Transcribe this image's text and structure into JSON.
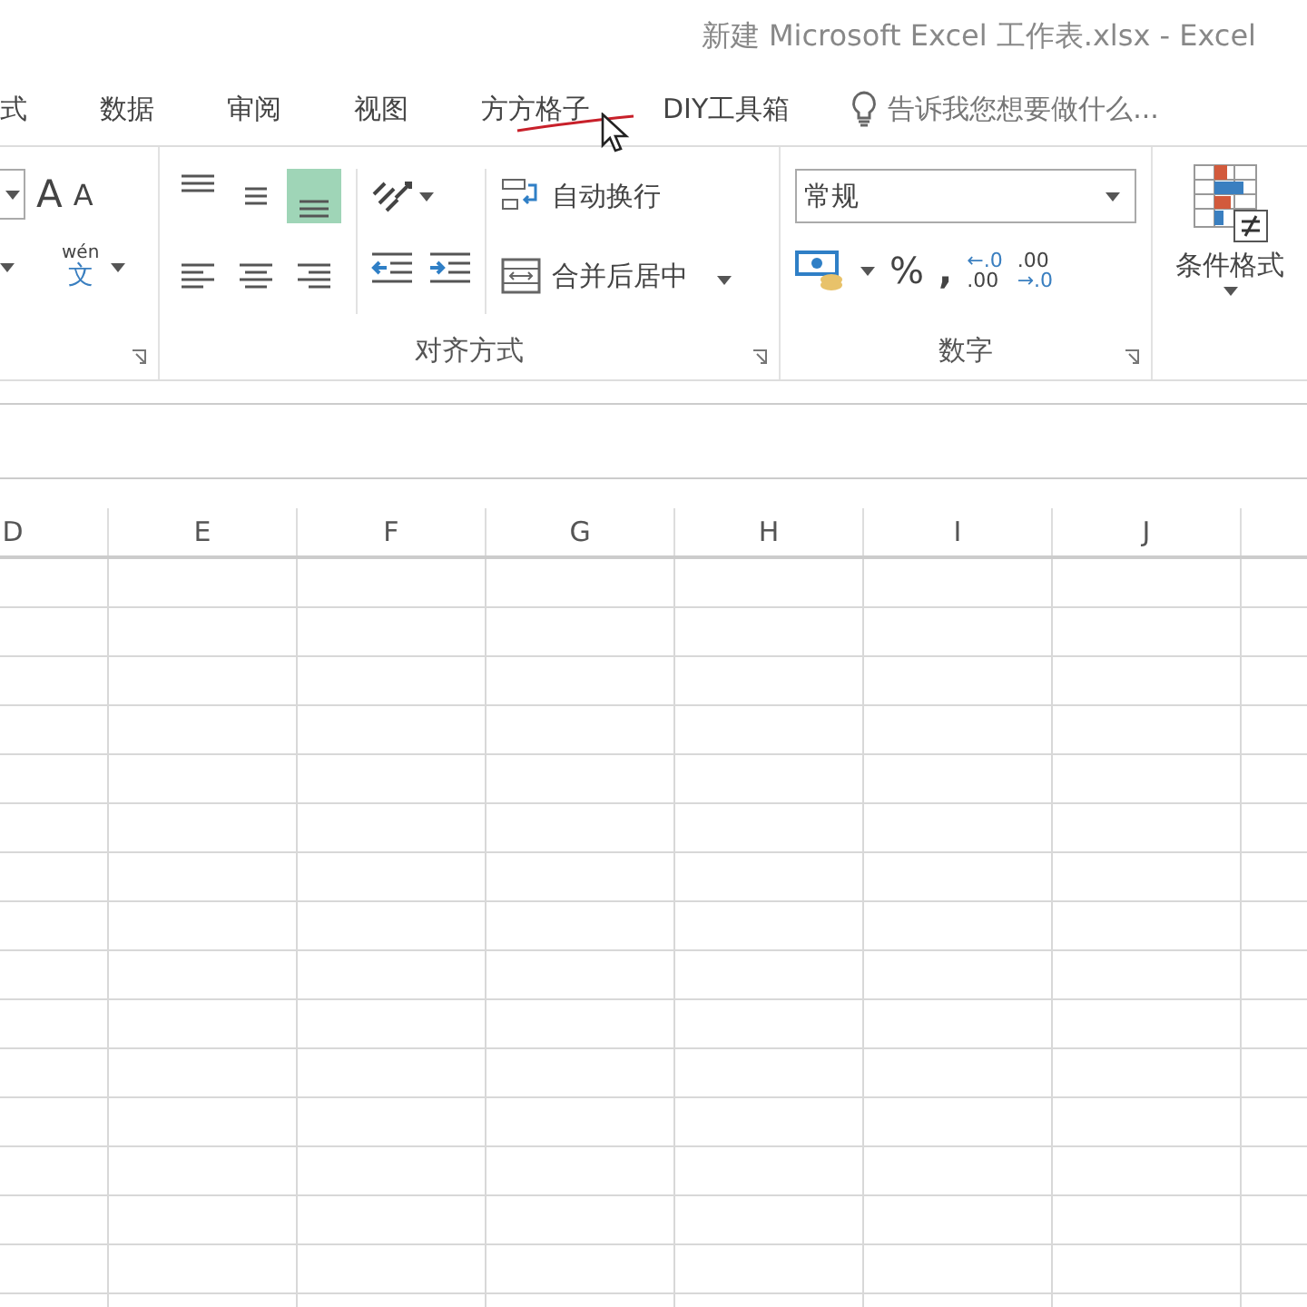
{
  "window": {
    "title": "新建 Microsoft Excel 工作表.xlsx - Excel"
  },
  "tabs": [
    {
      "label": "式"
    },
    {
      "label": "数据"
    },
    {
      "label": "审阅"
    },
    {
      "label": "视图"
    },
    {
      "label": "方方格子"
    },
    {
      "label": "DIY工具箱"
    }
  ],
  "tell_me": {
    "placeholder": "告诉我您想要做什么..."
  },
  "font_group": {
    "grow_font": "A",
    "shrink_font": "A",
    "phonetic_ruby": "wén",
    "phonetic_base": "文"
  },
  "alignment": {
    "label": "对齐方式",
    "buttons": [
      {
        "kind": "top",
        "selected": false
      },
      {
        "kind": "middle",
        "selected": false
      },
      {
        "kind": "bottom",
        "selected": true
      },
      {
        "kind": "left",
        "selected": false
      },
      {
        "kind": "center",
        "selected": false
      },
      {
        "kind": "right",
        "selected": false
      }
    ],
    "wrap_text": "自动换行",
    "merge_center": "合并后居中"
  },
  "number": {
    "label": "数字",
    "format": "常规",
    "percent": "%",
    "comma": ",",
    "decimal_buttons": [
      {
        "kind": "increase",
        "top": "←.0",
        "bottom": ".00"
      },
      {
        "kind": "decrease",
        "top": ".00",
        "bottom": "→.0"
      }
    ]
  },
  "styles": {
    "conditional_format": "条件格式"
  },
  "sheet": {
    "columns": [
      "D",
      "E",
      "F",
      "G",
      "H",
      "I",
      "J"
    ]
  }
}
